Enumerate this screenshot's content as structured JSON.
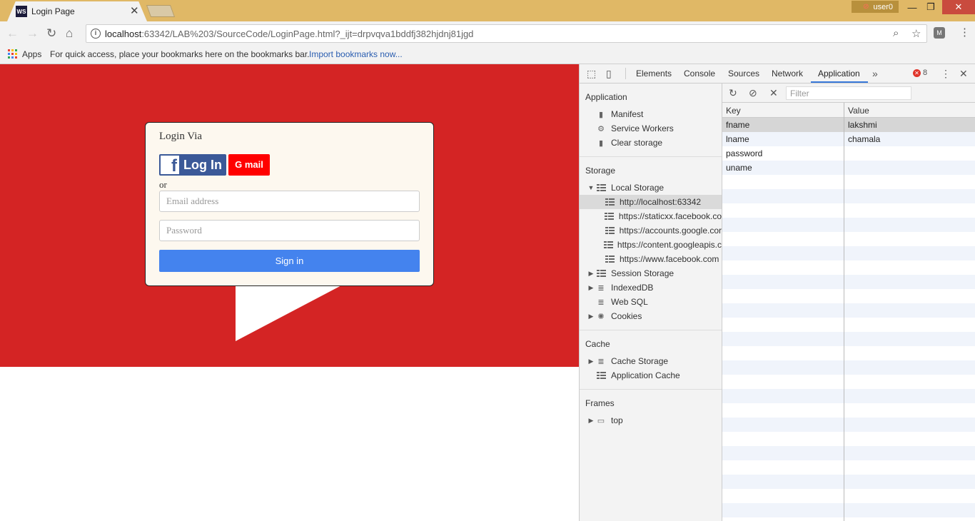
{
  "browser": {
    "tab_title": "Login Page",
    "tab_favicon": "WS",
    "user_name": "user0",
    "url_host": "localhost",
    "url_rest": ":63342/LAB%203/SourceCode/LoginPage.html?_ijt=drpvqva1bddfj382hjdnj81jgd",
    "apps_label": "Apps",
    "bookmarks_hint": "For quick access, place your bookmarks here on the bookmarks bar.",
    "bookmarks_link": "Import bookmarks now...",
    "colors": {
      "titlebar": "#e0b866",
      "toolbar": "#f2f2f2"
    }
  },
  "page": {
    "hero_color": "#d42424",
    "login": {
      "title": "Login Via",
      "facebook_button": "Log In",
      "facebook_icon": "f",
      "gmail_button": "G mail",
      "or_text": "or",
      "email_placeholder": "Email address",
      "password_placeholder": "Password",
      "signin_button": "Sign in"
    }
  },
  "devtools": {
    "tabs": [
      "Elements",
      "Console",
      "Sources",
      "Network",
      "Application"
    ],
    "active_tab": "Application",
    "error_count": "8",
    "sidebar": {
      "application_header": "Application",
      "application_items": [
        "Manifest",
        "Service Workers",
        "Clear storage"
      ],
      "storage_header": "Storage",
      "local_storage": "Local Storage",
      "local_storage_origins": [
        "http://localhost:63342",
        "https://staticxx.facebook.co",
        "https://accounts.google.cor",
        "https://content.googleapis.c",
        "https://www.facebook.com"
      ],
      "storage_items": [
        "Session Storage",
        "IndexedDB",
        "Web SQL",
        "Cookies"
      ],
      "cache_header": "Cache",
      "cache_items": [
        "Cache Storage",
        "Application Cache"
      ],
      "frames_header": "Frames",
      "frames_items": [
        "top"
      ]
    },
    "filter_placeholder": "Filter",
    "table": {
      "key_header": "Key",
      "value_header": "Value",
      "rows": [
        {
          "key": "fname",
          "value": "lakshmi"
        },
        {
          "key": "lname",
          "value": "chamala"
        },
        {
          "key": "password",
          "value": ""
        },
        {
          "key": "uname",
          "value": ""
        }
      ]
    }
  }
}
